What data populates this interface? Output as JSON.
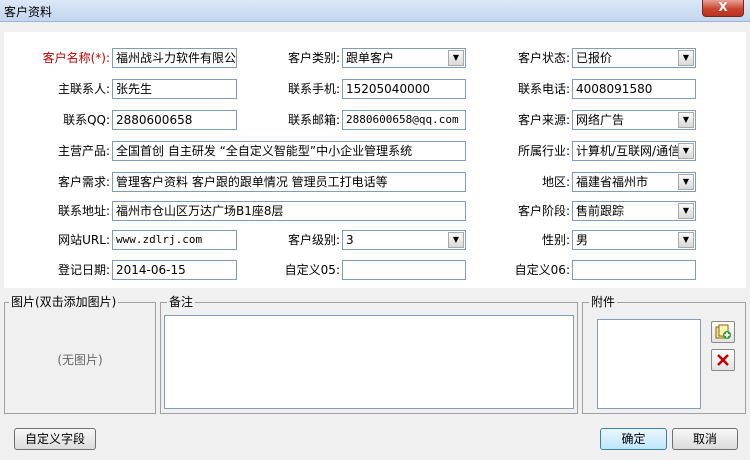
{
  "window": {
    "title": "客户资料",
    "close_label": "X"
  },
  "form": {
    "customer_name": {
      "label": "客户名称(*):",
      "value": "福州战斗力软件有限公司"
    },
    "customer_type": {
      "label": "客户类别:",
      "value": "跟单客户"
    },
    "customer_status": {
      "label": "客户状态:",
      "value": "已报价"
    },
    "main_contact": {
      "label": "主联系人:",
      "value": "张先生"
    },
    "contact_mobile": {
      "label": "联系手机:",
      "value": "15205040000"
    },
    "contact_phone": {
      "label": "联系电话:",
      "value": "4008091580"
    },
    "contact_qq": {
      "label": "联系QQ:",
      "value": "2880600658"
    },
    "contact_email": {
      "label": "联系邮箱:",
      "value": "2880600658@qq.com"
    },
    "customer_source": {
      "label": "客户来源:",
      "value": "网络广告"
    },
    "main_products": {
      "label": "主营产品:",
      "value": "全国首创 自主研发 “全自定义智能型”中小企业管理系统"
    },
    "industry": {
      "label": "所属行业:",
      "value": "计算机/互联网/通信"
    },
    "customer_needs": {
      "label": "客户需求:",
      "value": "管理客户资料  客户跟的跟单情况 管理员工打电话等"
    },
    "region": {
      "label": "地区:",
      "value": "福建省福州市"
    },
    "contact_address": {
      "label": "联系地址:",
      "value": "福州市仓山区万达广场B1座8层"
    },
    "customer_stage": {
      "label": "客户阶段:",
      "value": "售前跟踪"
    },
    "website": {
      "label": "网站URL:",
      "value": "www.zdlrj.com"
    },
    "customer_level": {
      "label": "客户级别:",
      "value": "3"
    },
    "gender": {
      "label": "性别:",
      "value": "男"
    },
    "register_date": {
      "label": "登记日期:",
      "value": "2014-06-15"
    },
    "custom05": {
      "label": "自定义05:",
      "value": ""
    },
    "custom06": {
      "label": "自定义06:",
      "value": ""
    }
  },
  "picture": {
    "title": "图片(双击添加图片)",
    "empty_text": "(无图片)"
  },
  "notes": {
    "title": "备注",
    "value": ""
  },
  "attachments": {
    "title": "附件"
  },
  "buttons": {
    "custom_fields": "自定义字段",
    "ok": "确定",
    "cancel": "取消"
  },
  "icons": {
    "add_attachment": "add-attachment-icon",
    "delete_attachment": "delete-x-icon"
  },
  "colors": {
    "required_label": "#c00000",
    "delete_icon": "#c00000"
  }
}
